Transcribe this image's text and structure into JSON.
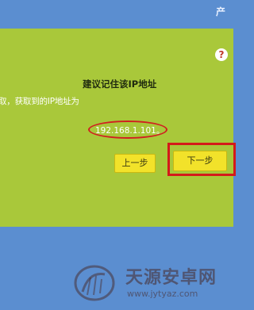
{
  "header": {
    "title_fragment": "产"
  },
  "dialog": {
    "help_label": "?",
    "heading": "建议记住该IP地址",
    "description": "取，获取到的IP地址为",
    "ip_address": "192.168.1.101。",
    "prev_button": "上一步",
    "next_button": "下一步"
  },
  "watermark": {
    "title": "天源安卓网",
    "url": "www.jytyaz.com"
  },
  "colors": {
    "panel": "#a9c83a",
    "background": "#5b8ed0",
    "button": "#f2e22a",
    "highlight": "#d41a1a"
  }
}
